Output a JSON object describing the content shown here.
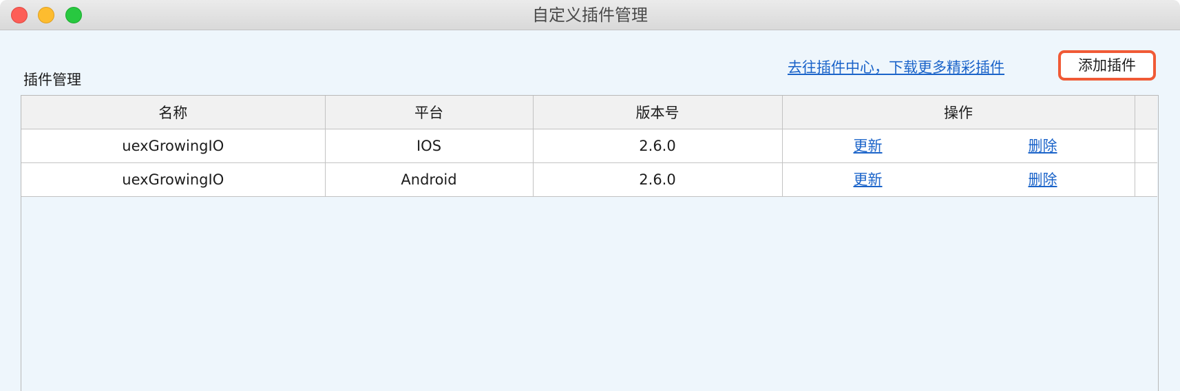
{
  "window": {
    "title": "自定义插件管理"
  },
  "section": {
    "label": "插件管理"
  },
  "header_actions": {
    "store_link": "去往插件中心，下载更多精彩插件",
    "add_button": "添加插件"
  },
  "table": {
    "columns": [
      "名称",
      "平台",
      "版本号",
      "操作"
    ],
    "rows": [
      {
        "name": "uexGrowingIO",
        "platform": "IOS",
        "version": "2.6.0",
        "update": "更新",
        "delete": "删除"
      },
      {
        "name": "uexGrowingIO",
        "platform": "Android",
        "version": "2.6.0",
        "update": "更新",
        "delete": "删除"
      }
    ]
  },
  "colors": {
    "link": "#1a63c9",
    "highlight_border": "#f05a36",
    "background": "#eef6fc"
  },
  "icons": [
    "close-button",
    "minimize-button",
    "zoom-button"
  ]
}
